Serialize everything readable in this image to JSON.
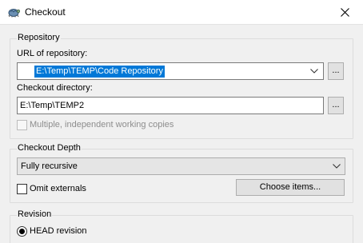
{
  "window": {
    "title": "Checkout",
    "app_icon": "tortoise-svn-icon",
    "close_icon": "close-icon"
  },
  "repository": {
    "group_label": "Repository",
    "url_label": "URL of repository:",
    "url_value": "E:\\Temp\\TEMP\\Code Repository",
    "url_browse_label": "...",
    "checkout_dir_label": "Checkout directory:",
    "checkout_dir_value": "E:\\Temp\\TEMP2",
    "checkout_dir_browse_label": "...",
    "multiple_copies_label": "Multiple, independent working copies",
    "multiple_copies_checked": false,
    "multiple_copies_enabled": false
  },
  "depth": {
    "group_label": "Checkout Depth",
    "selected": "Fully recursive",
    "omit_externals_label": "Omit externals",
    "omit_externals_checked": false,
    "choose_items_label": "Choose items..."
  },
  "revision": {
    "group_label": "Revision",
    "head_label": "HEAD revision",
    "head_selected": true
  }
}
